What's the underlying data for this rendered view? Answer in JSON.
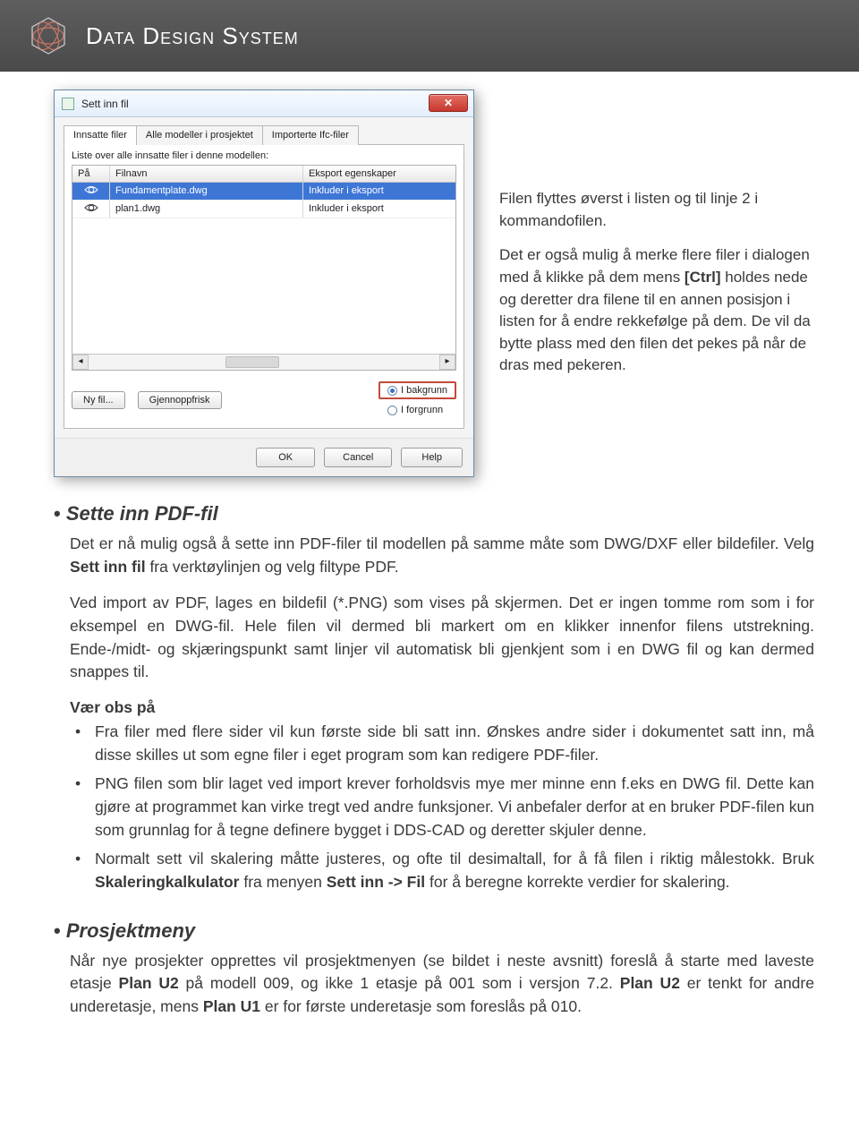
{
  "brand": "Data Design System",
  "dlg": {
    "title": "Sett inn fil",
    "tabs": [
      "Innsatte filer",
      "Alle modeller i prosjektet",
      "Importerte Ifc-filer"
    ],
    "list_label": "Liste over alle innsatte filer i denne modellen:",
    "cols": {
      "c1": "På",
      "c2": "Filnavn",
      "c3": "Eksport egenskaper"
    },
    "rows": [
      {
        "name": "Fundamentplate.dwg",
        "exp": "Inkluder i eksport"
      },
      {
        "name": "plan1.dwg",
        "exp": "Inkluder i eksport"
      }
    ],
    "btn_new": "Ny fil...",
    "btn_refresh": "Gjennoppfrisk",
    "radio_bg": "I bakgrunn",
    "radio_fg": "I forgrunn",
    "ok": "OK",
    "cancel": "Cancel",
    "help": "Help"
  },
  "side": {
    "p1": "Filen flyttes øverst i listen og til linje 2 i kommandofilen.",
    "p2a": "Det er også mulig å merke flere filer i dialogen med å klikke på dem mens ",
    "p2b": "[Ctrl]",
    "p2c": " holdes nede og deretter dra filene til en annen posisjon i listen for å endre rekkefølge på dem. De vil da bytte plass med den filen det pekes på når de dras med pekeren."
  },
  "sec1": {
    "title": "Sette inn PDF-fil",
    "p1a": "Det er nå mulig også å sette inn PDF-filer til modellen på samme måte som DWG/DXF eller bildefiler. Velg ",
    "p1b": "Sett inn fil",
    "p1c": " fra verktøylinjen og velg filtype PDF.",
    "p2": "Ved import av PDF, lages en bildefil (*.PNG) som vises på skjermen. Det er ingen tomme rom som i for eksempel en DWG-fil. Hele filen vil dermed bli markert om en klikker innenfor filens utstrekning. Ende-/midt- og skjæringspunkt samt linjer vil automatisk bli gjenkjent som i en DWG fil og kan dermed snappes til.",
    "note_label": "Vær obs på",
    "n1": "Fra filer med flere sider vil kun første side bli satt inn. Ønskes andre sider i dokumentet satt inn, må disse skilles ut som egne filer i eget program som kan redigere PDF-filer.",
    "n2": "PNG filen som blir laget ved import krever forholdsvis mye mer minne enn f.eks en DWG fil. Dette kan gjøre at programmet kan virke tregt ved andre funksjoner. Vi anbefaler derfor at en bruker PDF-filen kun som grunnlag for å tegne definere bygget i DDS-CAD og deretter skjuler denne.",
    "n3a": "Normalt sett vil skalering måtte justeres, og ofte til desimaltall, for å få filen i riktig målestokk. Bruk ",
    "n3b": "Skaleringkalkulator",
    "n3c": " fra menyen ",
    "n3d": "Sett inn -> Fil",
    "n3e": " for å beregne korrekte verdier for skalering."
  },
  "sec2": {
    "title": "Prosjektmeny",
    "p1a": "Når nye prosjekter opprettes vil prosjektmenyen (se bildet i neste avsnitt) foreslå å starte med laveste etasje ",
    "p1b": "Plan U2",
    "p1c": " på modell 009, og ikke 1 etasje på 001 som i versjon 7.2. ",
    "p1d": "Plan U2",
    "p1e": " er tenkt for andre underetasje, mens ",
    "p1f": "Plan U1",
    "p1g": " er for første underetasje som foreslås på 010."
  }
}
